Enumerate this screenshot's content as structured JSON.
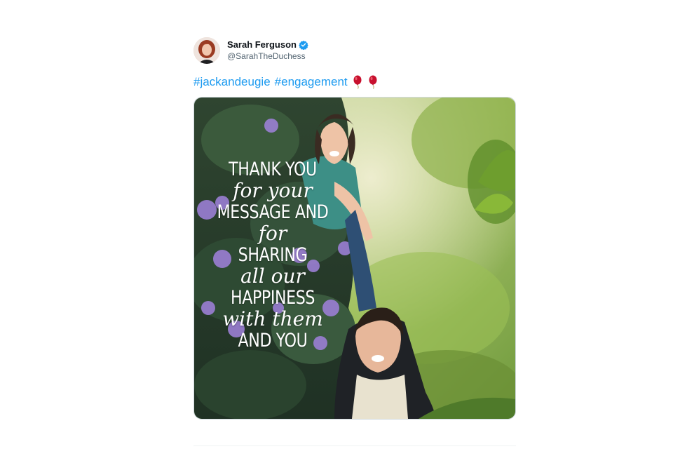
{
  "tweet": {
    "author": {
      "display_name": "Sarah Ferguson",
      "handle": "@SarahTheDuchess",
      "verified": true
    },
    "text": {
      "hashtags": [
        "#jackandeugie",
        "#engagement"
      ],
      "emoji": [
        "balloon-icon",
        "balloon-icon"
      ]
    },
    "media": {
      "overlay_lines": [
        {
          "text": "THANK YOU",
          "style": "caps"
        },
        {
          "text": "for your",
          "style": "script"
        },
        {
          "text": "MESSAGE AND",
          "style": "caps"
        },
        {
          "text": "for",
          "style": "script"
        },
        {
          "text": "SHARING",
          "style": "caps"
        },
        {
          "text": "all our",
          "style": "script"
        },
        {
          "text": "HAPPINESS",
          "style": "caps"
        },
        {
          "text": "with them",
          "style": "script"
        },
        {
          "text": "AND YOU",
          "style": "caps"
        }
      ]
    }
  },
  "colors": {
    "hashtag": "#1d9bf0",
    "verified_badge": "#1d9bf0",
    "handle": "#536471",
    "balloon": "#c8102e"
  }
}
